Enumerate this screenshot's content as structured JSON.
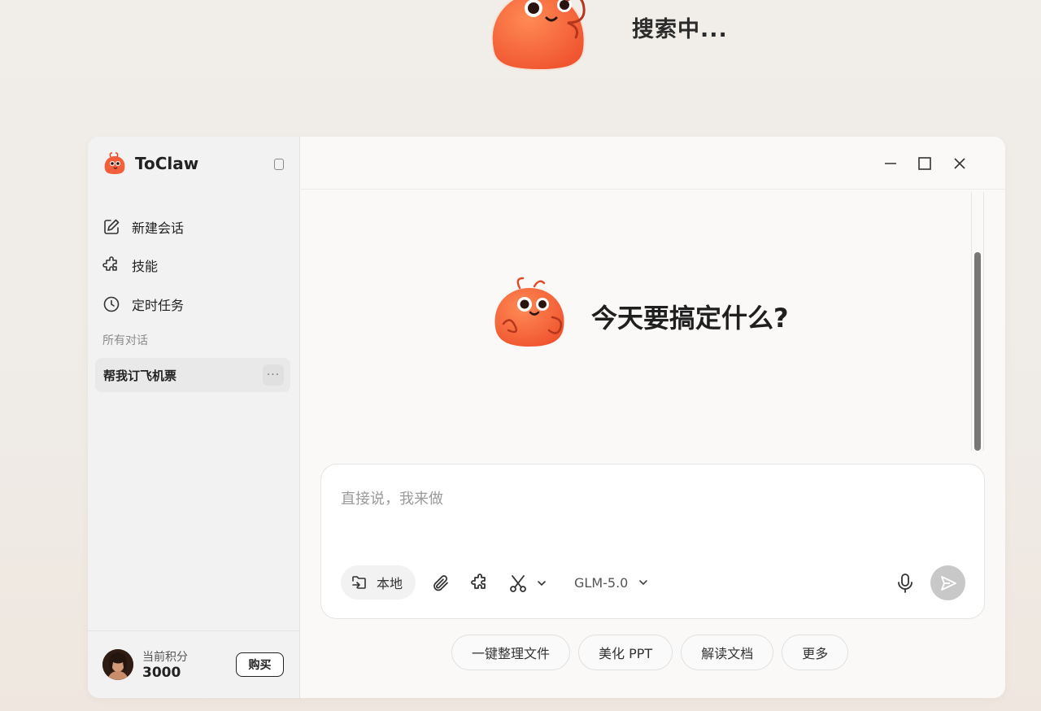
{
  "top_overlay": {
    "status_text": "搜索中..."
  },
  "app": {
    "name": "ToClaw"
  },
  "sidebar": {
    "nav": [
      {
        "label": "新建会话",
        "icon": "edit-icon"
      },
      {
        "label": "技能",
        "icon": "puzzle-icon"
      },
      {
        "label": "定时任务",
        "icon": "clock-icon"
      }
    ],
    "section_title": "所有对话",
    "conversations": [
      {
        "label": "帮我订飞机票",
        "more": "···"
      }
    ],
    "footer": {
      "points_label": "当前积分",
      "points_value": "3000",
      "buy_label": "购买"
    }
  },
  "main": {
    "hero_title": "今天要搞定什么?",
    "composer": {
      "placeholder": "直接说，我来做",
      "local_label": "本地",
      "model_label": "GLM-5.0"
    },
    "chips": [
      "一键整理文件",
      "美化 PPT",
      "解读文档",
      "更多"
    ]
  },
  "colors": {
    "accent": "#ff6a3d",
    "send_disabled": "#c8c8c8"
  }
}
